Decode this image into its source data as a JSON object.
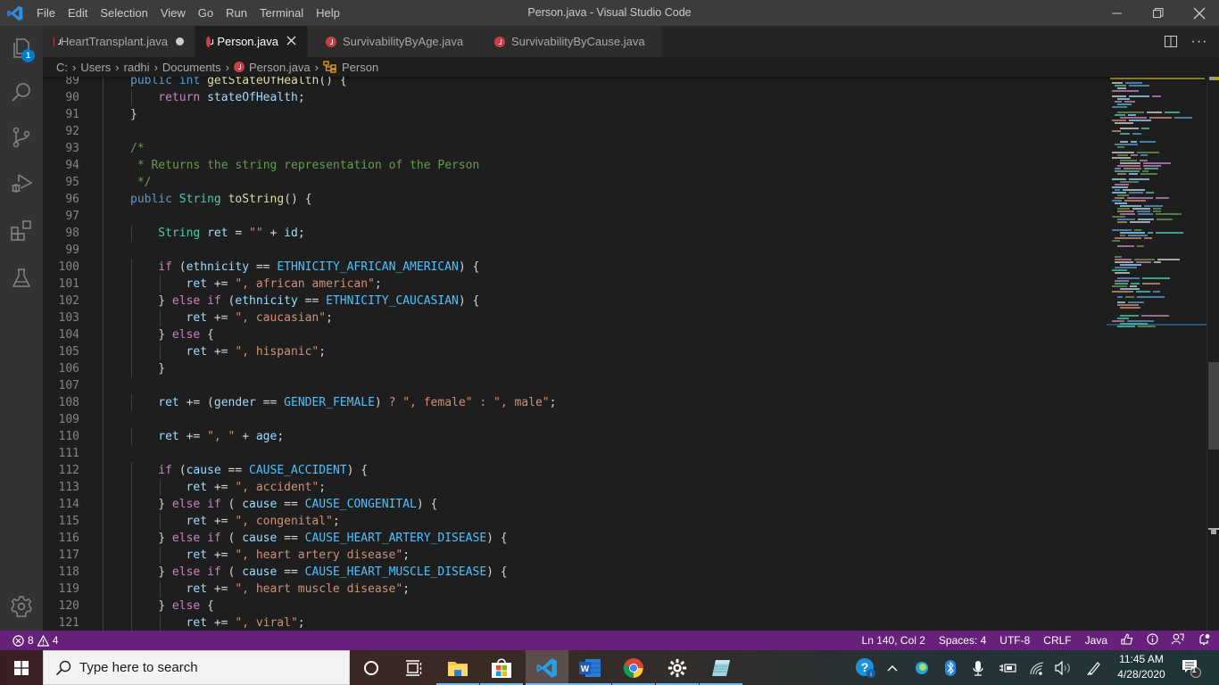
{
  "window": {
    "title": "Person.java - Visual Studio Code",
    "menu": [
      "File",
      "Edit",
      "Selection",
      "View",
      "Go",
      "Run",
      "Terminal",
      "Help"
    ]
  },
  "activity_bar": {
    "explorer_badge": "1",
    "items": [
      "explorer",
      "search",
      "source-control",
      "run-debug",
      "extensions",
      "testing"
    ],
    "bottom": "manage"
  },
  "tabs": [
    {
      "label": "HeartTransplant.java",
      "state": "modified",
      "active": false
    },
    {
      "label": "Person.java",
      "state": "close",
      "active": true
    },
    {
      "label": "SurvivabilityByAge.java",
      "state": "",
      "active": false
    },
    {
      "label": "SurvivabilityByCause.java",
      "state": "",
      "active": false
    }
  ],
  "breadcrumb": [
    "C:",
    "Users",
    "radhi",
    "Documents",
    "Person.java",
    "Person"
  ],
  "editor": {
    "lines": [
      {
        "n": "89",
        "indent": 1,
        "tokens": [
          [
            "kw",
            "public"
          ],
          [
            "pl",
            " "
          ],
          [
            "kw",
            "int"
          ],
          [
            "pl",
            " "
          ],
          [
            "fn",
            "getStateOfHealth"
          ],
          [
            "pl",
            "() {"
          ]
        ]
      },
      {
        "n": "90",
        "indent": 2,
        "tokens": [
          [
            "ctl",
            "return"
          ],
          [
            "pl",
            " "
          ],
          [
            "var",
            "stateOfHealth"
          ],
          [
            "pl",
            ";"
          ]
        ]
      },
      {
        "n": "91",
        "indent": 1,
        "tokens": [
          [
            "pl",
            "}"
          ]
        ]
      },
      {
        "n": "92",
        "indent": 0,
        "tokens": []
      },
      {
        "n": "93",
        "indent": 1,
        "tokens": [
          [
            "cm",
            "/*"
          ]
        ]
      },
      {
        "n": "94",
        "indent": 1,
        "tokens": [
          [
            "cm",
            " * Returns the string representation of the Person"
          ]
        ]
      },
      {
        "n": "95",
        "indent": 1,
        "tokens": [
          [
            "cm",
            " */"
          ]
        ]
      },
      {
        "n": "96",
        "indent": 1,
        "tokens": [
          [
            "kw",
            "public"
          ],
          [
            "pl",
            " "
          ],
          [
            "ty",
            "String"
          ],
          [
            "pl",
            " "
          ],
          [
            "fn",
            "toString"
          ],
          [
            "pl",
            "() {"
          ]
        ]
      },
      {
        "n": "97",
        "indent": 0,
        "tokens": []
      },
      {
        "n": "98",
        "indent": 2,
        "tokens": [
          [
            "ty",
            "String"
          ],
          [
            "pl",
            " "
          ],
          [
            "var",
            "ret"
          ],
          [
            "pl",
            " = "
          ],
          [
            "str",
            "\"\""
          ],
          [
            "pl",
            " + "
          ],
          [
            "var",
            "id"
          ],
          [
            "pl",
            ";"
          ]
        ]
      },
      {
        "n": "99",
        "indent": 0,
        "tokens": []
      },
      {
        "n": "100",
        "indent": 2,
        "tokens": [
          [
            "ctl",
            "if"
          ],
          [
            "pl",
            " ("
          ],
          [
            "var",
            "ethnicity"
          ],
          [
            "pl",
            " == "
          ],
          [
            "cn",
            "ETHNICITY_AFRICAN_AMERICAN"
          ],
          [
            "pl",
            ") {"
          ]
        ]
      },
      {
        "n": "101",
        "indent": 3,
        "tokens": [
          [
            "var",
            "ret"
          ],
          [
            "pl",
            " += "
          ],
          [
            "str",
            "\", african american\""
          ],
          [
            "pl",
            ";"
          ]
        ]
      },
      {
        "n": "102",
        "indent": 2,
        "tokens": [
          [
            "pl",
            "} "
          ],
          [
            "ctl",
            "else"
          ],
          [
            "pl",
            " "
          ],
          [
            "ctl",
            "if"
          ],
          [
            "pl",
            " ("
          ],
          [
            "var",
            "ethnicity"
          ],
          [
            "pl",
            " == "
          ],
          [
            "cn",
            "ETHNICITY_CAUCASIAN"
          ],
          [
            "pl",
            ") {"
          ]
        ]
      },
      {
        "n": "103",
        "indent": 3,
        "tokens": [
          [
            "var",
            "ret"
          ],
          [
            "pl",
            " += "
          ],
          [
            "str",
            "\", caucasian\""
          ],
          [
            "pl",
            ";"
          ]
        ]
      },
      {
        "n": "104",
        "indent": 2,
        "tokens": [
          [
            "pl",
            "} "
          ],
          [
            "ctl",
            "else"
          ],
          [
            "pl",
            " {"
          ]
        ]
      },
      {
        "n": "105",
        "indent": 3,
        "tokens": [
          [
            "var",
            "ret"
          ],
          [
            "pl",
            " += "
          ],
          [
            "str",
            "\", hispanic\""
          ],
          [
            "pl",
            ";"
          ]
        ]
      },
      {
        "n": "106",
        "indent": 2,
        "tokens": [
          [
            "pl",
            "}"
          ]
        ]
      },
      {
        "n": "107",
        "indent": 0,
        "tokens": []
      },
      {
        "n": "108",
        "indent": 2,
        "tokens": [
          [
            "var",
            "ret"
          ],
          [
            "pl",
            " += ("
          ],
          [
            "var",
            "gender"
          ],
          [
            "pl",
            " == "
          ],
          [
            "cn",
            "GENDER_FEMALE"
          ],
          [
            "pl",
            ") "
          ],
          [
            "ctl",
            "?"
          ],
          [
            "pl",
            " "
          ],
          [
            "str",
            "\", female\""
          ],
          [
            "pl",
            " "
          ],
          [
            "ctl",
            ":"
          ],
          [
            "pl",
            " "
          ],
          [
            "str",
            "\", male\""
          ],
          [
            "pl",
            ";"
          ]
        ]
      },
      {
        "n": "109",
        "indent": 0,
        "tokens": []
      },
      {
        "n": "110",
        "indent": 2,
        "tokens": [
          [
            "var",
            "ret"
          ],
          [
            "pl",
            " += "
          ],
          [
            "str",
            "\", \""
          ],
          [
            "pl",
            " + "
          ],
          [
            "var",
            "age"
          ],
          [
            "pl",
            ";"
          ]
        ]
      },
      {
        "n": "111",
        "indent": 0,
        "tokens": []
      },
      {
        "n": "112",
        "indent": 2,
        "tokens": [
          [
            "ctl",
            "if"
          ],
          [
            "pl",
            " ("
          ],
          [
            "var",
            "cause"
          ],
          [
            "pl",
            " == "
          ],
          [
            "cn",
            "CAUSE_ACCIDENT"
          ],
          [
            "pl",
            ") {"
          ]
        ]
      },
      {
        "n": "113",
        "indent": 3,
        "tokens": [
          [
            "var",
            "ret"
          ],
          [
            "pl",
            " += "
          ],
          [
            "str",
            "\", accident\""
          ],
          [
            "pl",
            ";"
          ]
        ]
      },
      {
        "n": "114",
        "indent": 2,
        "tokens": [
          [
            "pl",
            "} "
          ],
          [
            "ctl",
            "else"
          ],
          [
            "pl",
            " "
          ],
          [
            "ctl",
            "if"
          ],
          [
            "pl",
            " ( "
          ],
          [
            "var",
            "cause"
          ],
          [
            "pl",
            " == "
          ],
          [
            "cn",
            "CAUSE_CONGENITAL"
          ],
          [
            "pl",
            ") {"
          ]
        ]
      },
      {
        "n": "115",
        "indent": 3,
        "tokens": [
          [
            "var",
            "ret"
          ],
          [
            "pl",
            " += "
          ],
          [
            "str",
            "\", congenital\""
          ],
          [
            "pl",
            ";"
          ]
        ]
      },
      {
        "n": "116",
        "indent": 2,
        "tokens": [
          [
            "pl",
            "} "
          ],
          [
            "ctl",
            "else"
          ],
          [
            "pl",
            " "
          ],
          [
            "ctl",
            "if"
          ],
          [
            "pl",
            " ( "
          ],
          [
            "var",
            "cause"
          ],
          [
            "pl",
            " == "
          ],
          [
            "cn",
            "CAUSE_HEART_ARTERY_DISEASE"
          ],
          [
            "pl",
            ") {"
          ]
        ]
      },
      {
        "n": "117",
        "indent": 3,
        "tokens": [
          [
            "var",
            "ret"
          ],
          [
            "pl",
            " += "
          ],
          [
            "str",
            "\", heart artery disease\""
          ],
          [
            "pl",
            ";"
          ]
        ]
      },
      {
        "n": "118",
        "indent": 2,
        "tokens": [
          [
            "pl",
            "} "
          ],
          [
            "ctl",
            "else"
          ],
          [
            "pl",
            " "
          ],
          [
            "ctl",
            "if"
          ],
          [
            "pl",
            " ( "
          ],
          [
            "var",
            "cause"
          ],
          [
            "pl",
            " == "
          ],
          [
            "cn",
            "CAUSE_HEART_MUSCLE_DISEASE"
          ],
          [
            "pl",
            ") {"
          ]
        ]
      },
      {
        "n": "119",
        "indent": 3,
        "tokens": [
          [
            "var",
            "ret"
          ],
          [
            "pl",
            " += "
          ],
          [
            "str",
            "\", heart muscle disease\""
          ],
          [
            "pl",
            ";"
          ]
        ]
      },
      {
        "n": "120",
        "indent": 2,
        "tokens": [
          [
            "pl",
            "} "
          ],
          [
            "ctl",
            "else"
          ],
          [
            "pl",
            " {"
          ]
        ]
      },
      {
        "n": "121",
        "indent": 3,
        "tokens": [
          [
            "var",
            "ret"
          ],
          [
            "pl",
            " += "
          ],
          [
            "str",
            "\", viral\""
          ],
          [
            "pl",
            ";"
          ]
        ]
      }
    ]
  },
  "status_bar": {
    "errors": "8",
    "warnings": "4",
    "cursor": "Ln 140, Col 2",
    "indent": "Spaces: 4",
    "encoding": "UTF-8",
    "eol": "CRLF",
    "language": "Java"
  },
  "taskbar": {
    "search_placeholder": "Type here to search",
    "apps": [
      "cortana",
      "task-view",
      "file-explorer",
      "microsoft-store",
      "vscode",
      "word",
      "chrome",
      "settings",
      "notepad"
    ],
    "time": "11:45 AM",
    "date": "4/28/2020",
    "notifications": "1"
  },
  "colors": {
    "statusbar": "#68217a",
    "accent": "#007acc",
    "java_icon": "#cc3e44"
  }
}
